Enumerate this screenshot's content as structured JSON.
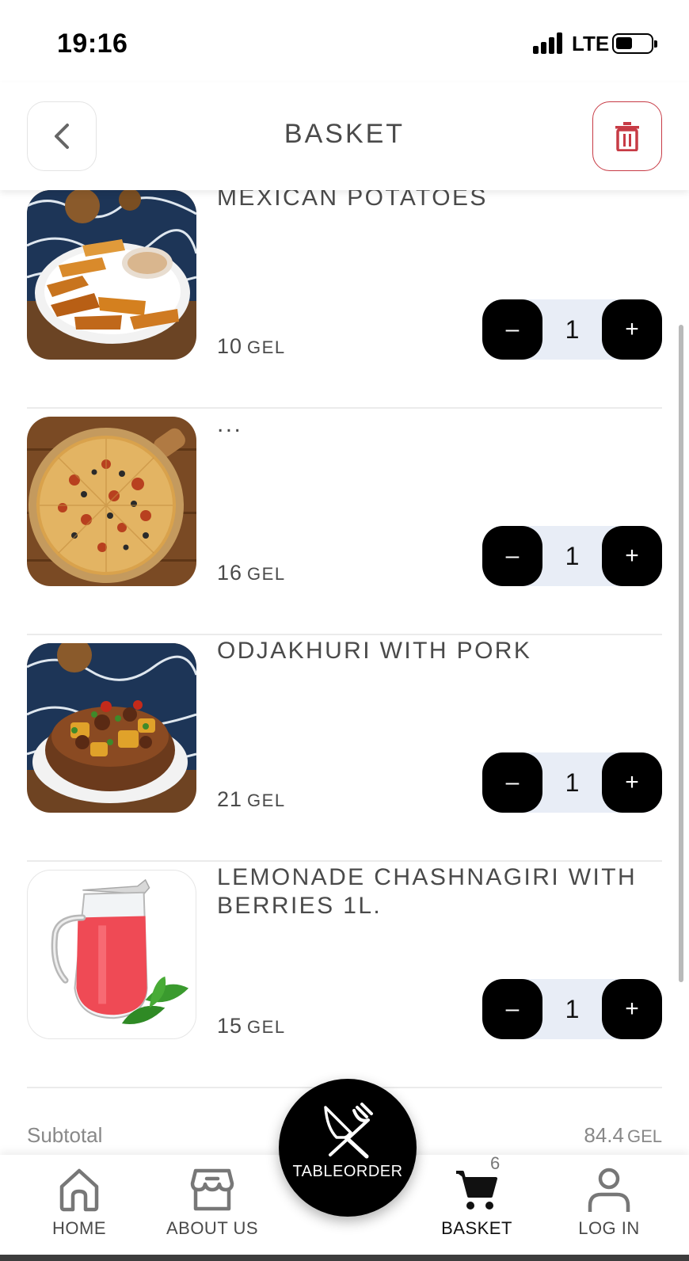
{
  "status_bar": {
    "time": "19:16",
    "network": "LTE"
  },
  "header": {
    "title": "BASKET"
  },
  "currency": "GEL",
  "items": [
    {
      "name": "MEXICAN POTATOES",
      "price": "10",
      "quantity": "1"
    },
    {
      "name": "...",
      "price": "16",
      "quantity": "1"
    },
    {
      "name": "ODJAKHURI WITH PORK",
      "price": "21",
      "quantity": "1"
    },
    {
      "name": "LEMONADE CHASHNAGIRI WITH BERRIES 1L.",
      "price": "15",
      "quantity": "1"
    }
  ],
  "stepper": {
    "minus": "–",
    "plus": "+"
  },
  "subtotal": {
    "label": "Subtotal",
    "value": "84.4",
    "currency": "GEL"
  },
  "nav": {
    "home": "HOME",
    "about": "ABOUT US",
    "center": "TABLEORDER",
    "basket": "BASKET",
    "basket_badge": "6",
    "login": "LOG IN"
  },
  "colors": {
    "accent": "#c73b45",
    "dark": "#000000",
    "stepper_bg": "#e8edf6"
  }
}
